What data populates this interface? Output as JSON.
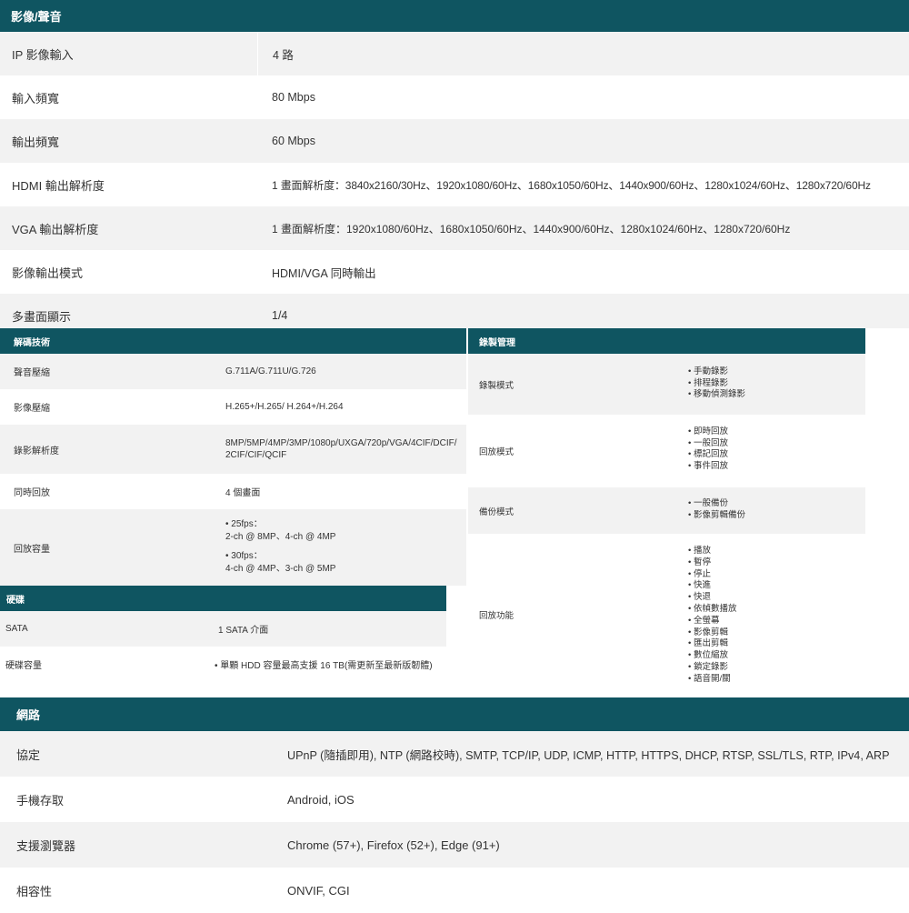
{
  "av": {
    "title": "影像/聲音",
    "rows": [
      {
        "label": "IP 影像輸入",
        "value": "4 路"
      },
      {
        "label": "輸入頻寬",
        "value": "80 Mbps"
      },
      {
        "label": "輸出頻寬",
        "value": "60 Mbps"
      },
      {
        "label": "HDMI 輸出解析度",
        "value": "1 畫面解析度：3840x2160/30Hz、1920x1080/60Hz、1680x1050/60Hz、1440x900/60Hz、1280x1024/60Hz、1280x720/60Hz"
      },
      {
        "label": "VGA 輸出解析度",
        "value": "1 畫面解析度：1920x1080/60Hz、1680x1050/60Hz、1440x900/60Hz、1280x1024/60Hz、1280x720/60Hz"
      },
      {
        "label": "影像輸出模式",
        "value": "HDMI/VGA 同時輸出"
      },
      {
        "label": "多畫面顯示",
        "value": "1/4"
      }
    ]
  },
  "decode": {
    "title": "解碼技術",
    "rows": [
      {
        "label": "聲音壓縮",
        "value": "G.711A/G.711U/G.726"
      },
      {
        "label": "影像壓縮",
        "value": "H.265+/H.265/ H.264+/H.264"
      },
      {
        "label": "錄影解析度",
        "value": "8MP/5MP/4MP/3MP/1080p/UXGA/720p/VGA/4CIF/DCIF/ 2CIF/CIF/QCIF"
      },
      {
        "label": "同時回放",
        "value": "4 個畫面"
      },
      {
        "label": "回放容量",
        "lines": [
          "• 25fps：",
          "2-ch @ 8MP、4-ch @ 4MP",
          "",
          "• 30fps：",
          "4-ch @ 4MP、3-ch @ 5MP"
        ]
      }
    ]
  },
  "record": {
    "title": "錄製管理",
    "rows": [
      {
        "label": "錄製模式",
        "items": [
          "手動錄影",
          "排程錄影",
          "移動偵測錄影"
        ]
      },
      {
        "label": "回放模式",
        "items": [
          "即時回放",
          "一般回放",
          "標記回放",
          "事件回放"
        ]
      },
      {
        "label": "備份模式",
        "items": [
          "一般備份",
          "影像剪輯備份"
        ]
      },
      {
        "label": "回放功能",
        "items": [
          "播放",
          "暫停",
          "停止",
          "快進",
          "快退",
          "依幀數播放",
          "全螢幕",
          "影像剪輯",
          "匯出剪輯",
          "數位縮放",
          "鎖定錄影",
          "語音開/關"
        ]
      }
    ]
  },
  "disk": {
    "title": "硬碟",
    "rows": [
      {
        "label": "SATA",
        "value": "1 SATA 介面"
      },
      {
        "label": "硬碟容量",
        "value": "• 單顆 HDD 容量最高支援 16 TB(需更新至最新版韌體)"
      }
    ]
  },
  "network": {
    "title": "網路",
    "rows": [
      {
        "label": "協定",
        "value": "UPnP (隨插即用), NTP (網路校時), SMTP, TCP/IP, UDP, ICMP, HTTP, HTTPS, DHCP, RTSP, SSL/TLS, RTP, IPv4, ARP"
      },
      {
        "label": "手機存取",
        "value": "Android, iOS"
      },
      {
        "label": "支援瀏覽器",
        "value": "Chrome (57+), Firefox (52+), Edge (91+)"
      },
      {
        "label": "相容性",
        "value": "ONVIF, CGI"
      }
    ]
  },
  "colors": {
    "header": "#0f5561",
    "row_alt": "#f2f2f2"
  }
}
